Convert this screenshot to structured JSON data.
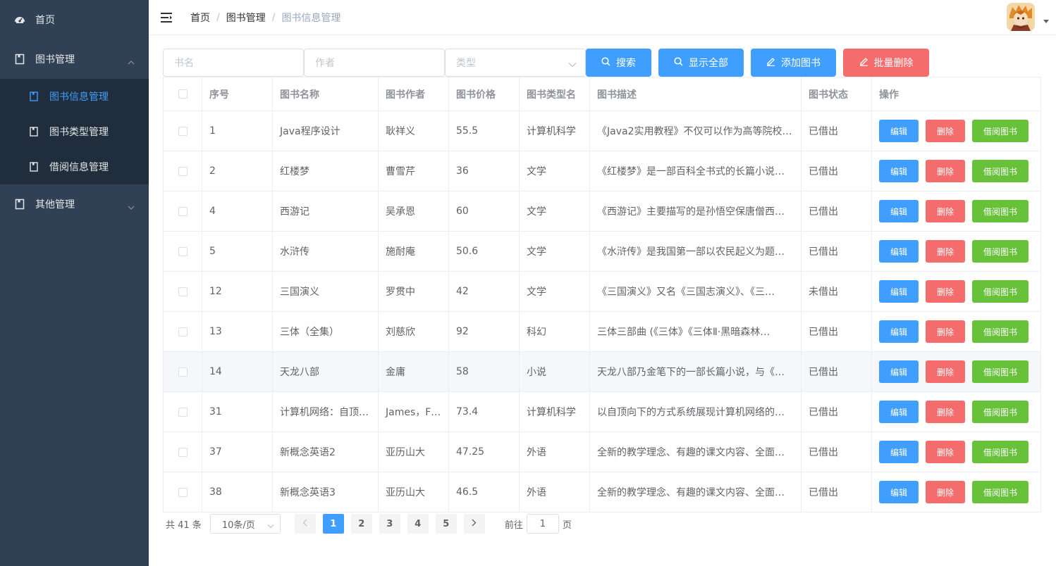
{
  "sidebar": {
    "home": {
      "label": "首页",
      "icon": "dashboard-icon"
    },
    "book_mgmt": {
      "label": "图书管理",
      "icon": "book-icon",
      "expanded": true
    },
    "sub_items": [
      {
        "label": "图书信息管理",
        "icon": "book-icon",
        "active": true
      },
      {
        "label": "图书类型管理",
        "icon": "book-icon"
      },
      {
        "label": "借阅信息管理",
        "icon": "book-icon"
      }
    ],
    "other_mgmt": {
      "label": "其他管理",
      "icon": "book-icon"
    }
  },
  "header": {
    "breadcrumbs": [
      "首页",
      "图书管理",
      "图书信息管理"
    ],
    "separator": "/"
  },
  "toolbar": {
    "book_name_placeholder": "书名",
    "author_placeholder": "作者",
    "type_placeholder": "类型",
    "search_label": "搜索",
    "show_all_label": "显示全部",
    "add_label": "添加图书",
    "batch_delete_label": "批量删除"
  },
  "table": {
    "columns": [
      "序号",
      "图书名称",
      "图书作者",
      "图书价格",
      "图书类型名",
      "图书描述",
      "图书状态",
      "操作"
    ],
    "row_actions": {
      "edit": "编辑",
      "delete": "删除",
      "borrow": "借阅图书"
    },
    "rows": [
      {
        "id": "1",
        "name": "Java程序设计",
        "author": "耿祥义",
        "price": "55.5",
        "type": "计算机科学",
        "desc": "《Java2实用教程》不仅可以作为高等院校…",
        "status": "已借出"
      },
      {
        "id": "2",
        "name": "红楼梦",
        "author": "曹雪芹",
        "price": "36",
        "type": "文学",
        "desc": "《红楼梦》是一部百科全书式的长篇小说…",
        "status": "已借出"
      },
      {
        "id": "4",
        "name": "西游记",
        "author": "吴承恩",
        "price": "60",
        "type": "文学",
        "desc": "《西游记》主要描写的是孙悟空保唐僧西…",
        "status": "已借出"
      },
      {
        "id": "5",
        "name": "水浒传",
        "author": "施耐庵",
        "price": "50.6",
        "type": "文学",
        "desc": "《水浒传》是我国第一部以农民起义为题…",
        "status": "已借出"
      },
      {
        "id": "12",
        "name": "三国演义",
        "author": "罗贯中",
        "price": "42",
        "type": "文学",
        "desc": "《三国演义》又名《三国志演义》、《三…",
        "status": "未借出"
      },
      {
        "id": "13",
        "name": "三体（全集）",
        "author": "刘慈欣",
        "price": "92",
        "type": "科幻",
        "desc": "三体三部曲 (《三体》《三体Ⅱ·黑暗森林…",
        "status": "已借出"
      },
      {
        "id": "14",
        "name": "天龙八部",
        "author": "金庸",
        "price": "58",
        "type": "小说",
        "desc": "天龙八部乃金笔下的一部长篇小说，与《…",
        "status": "已借出"
      },
      {
        "id": "31",
        "name": "计算机网络：自顶…",
        "author": "James，F…",
        "price": "73.4",
        "type": "计算机科学",
        "desc": "以自顶向下的方式系统展现计算机网络的…",
        "status": "已借出"
      },
      {
        "id": "37",
        "name": "新概念英语2",
        "author": "亚历山大",
        "price": "47.25",
        "type": "外语",
        "desc": "全新的教学理念、有趣的课文内容、全面…",
        "status": "已借出"
      },
      {
        "id": "38",
        "name": "新概念英语3",
        "author": "亚历山大",
        "price": "46.5",
        "type": "外语",
        "desc": "全新的教学理念、有趣的课文内容、全面…",
        "status": "已借出"
      }
    ]
  },
  "pagination": {
    "total_text": "共 41 条",
    "page_size": "10条/页",
    "pages": [
      "1",
      "2",
      "3",
      "4",
      "5"
    ],
    "current_page": "1",
    "goto_prefix": "前往",
    "goto_value": "1",
    "goto_suffix": "页"
  },
  "colors": {
    "sidebar_bg": "#304156",
    "submenu_bg": "#1f2d3d",
    "primary": "#409eff",
    "danger": "#f56c6c",
    "success": "#67c23a"
  }
}
